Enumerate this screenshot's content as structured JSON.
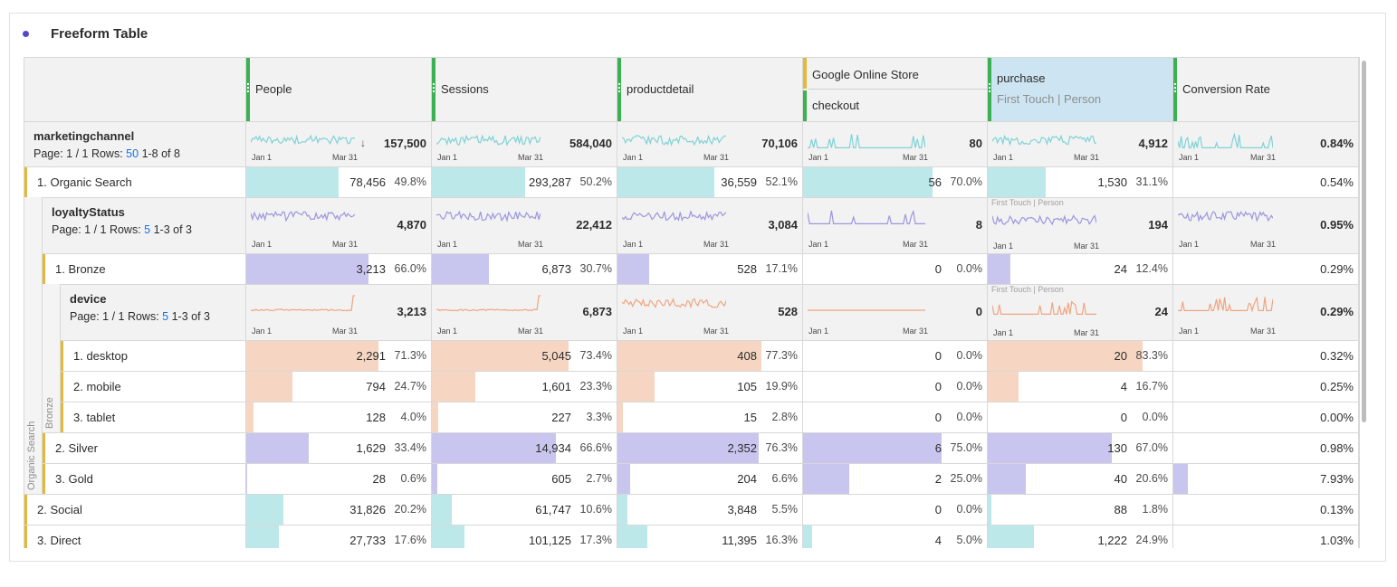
{
  "panel": {
    "title": "Freeform Table"
  },
  "colors": {
    "teal": "#bce8ea",
    "lavender": "#c8c5ee",
    "peach": "#f6d6c2",
    "green_bar": "#3bb151",
    "yellow_bar": "#e2b93b",
    "link": "#1473e6"
  },
  "columns": [
    {
      "label": "People"
    },
    {
      "label": "Sessions"
    },
    {
      "label": "productdetail"
    },
    {
      "label": "Google Online Store",
      "label2": "checkout"
    },
    {
      "label": "purchase",
      "label2": "First Touch | Person"
    },
    {
      "label": "Conversion Rate"
    }
  ],
  "spark_axis": {
    "start": "Jan 1",
    "end": "Mar 31"
  },
  "first_touch_label": "First Touch | Person",
  "side_labels": {
    "outer": "Organic Search",
    "inner": "Bronze"
  },
  "marketing": {
    "name": "marketingchannel",
    "page": "Page: 1 / 1",
    "rows_label": "Rows:",
    "rows": "50",
    "range": "1-8 of 8",
    "trend_icon": "arrow-down-icon",
    "totals": [
      "157,500",
      "584,040",
      "70,106",
      "80",
      "4,912",
      "0.84%"
    ]
  },
  "organic": {
    "label": "1. Organic Search",
    "values": [
      "78,456",
      "293,287",
      "36,559",
      "56",
      "1,530",
      "0.54%"
    ],
    "pcts": [
      "49.8%",
      "50.2%",
      "52.1%",
      "70.0%",
      "31.1%"
    ],
    "fractions": [
      0.498,
      0.502,
      0.521,
      0.7,
      0.311
    ]
  },
  "loyalty": {
    "name": "loyaltyStatus",
    "page": "Page: 1 / 1",
    "rows_label": "Rows:",
    "rows": "5",
    "range": "1-3 of 3",
    "totals": [
      "4,870",
      "22,412",
      "3,084",
      "8",
      "194",
      "0.95%"
    ]
  },
  "bronze": {
    "label": "1. Bronze",
    "values": [
      "3,213",
      "6,873",
      "528",
      "0",
      "24",
      "0.29%"
    ],
    "pcts": [
      "66.0%",
      "30.7%",
      "17.1%",
      "0.0%",
      "12.4%"
    ],
    "fractions": [
      0.66,
      0.307,
      0.171,
      0,
      0.124
    ]
  },
  "device": {
    "name": "device",
    "page": "Page: 1 / 1",
    "rows_label": "Rows:",
    "rows": "5",
    "range": "1-3 of 3",
    "totals": [
      "3,213",
      "6,873",
      "528",
      "0",
      "24",
      "0.29%"
    ]
  },
  "device_rows": [
    {
      "label": "1. desktop",
      "values": [
        "2,291",
        "5,045",
        "408",
        "0",
        "20",
        "0.32%"
      ],
      "pcts": [
        "71.3%",
        "73.4%",
        "77.3%",
        "0.0%",
        "83.3%"
      ],
      "fractions": [
        0.713,
        0.734,
        0.773,
        0,
        0.833
      ]
    },
    {
      "label": "2. mobile",
      "values": [
        "794",
        "1,601",
        "105",
        "0",
        "4",
        "0.25%"
      ],
      "pcts": [
        "24.7%",
        "23.3%",
        "19.9%",
        "0.0%",
        "16.7%"
      ],
      "fractions": [
        0.247,
        0.233,
        0.199,
        0,
        0.167
      ]
    },
    {
      "label": "3. tablet",
      "values": [
        "128",
        "227",
        "15",
        "0",
        "0",
        "0.00%"
      ],
      "pcts": [
        "4.0%",
        "3.3%",
        "2.8%",
        "0.0%",
        "0.0%"
      ],
      "fractions": [
        0.04,
        0.033,
        0.028,
        0,
        0
      ]
    }
  ],
  "loyalty_rows": [
    {
      "label": "2. Silver",
      "values": [
        "1,629",
        "14,934",
        "2,352",
        "6",
        "130",
        "0.98%"
      ],
      "pcts": [
        "33.4%",
        "66.6%",
        "76.3%",
        "75.0%",
        "67.0%"
      ],
      "fractions": [
        0.334,
        0.666,
        0.763,
        0.75,
        0.67
      ],
      "conv_fraction": 0
    },
    {
      "label": "3. Gold",
      "values": [
        "28",
        "605",
        "204",
        "2",
        "40",
        "7.93%"
      ],
      "pcts": [
        "0.6%",
        "2.7%",
        "6.6%",
        "25.0%",
        "20.6%"
      ],
      "fractions": [
        0.006,
        0.027,
        0.066,
        0.25,
        0.206
      ],
      "conv_fraction": 0.08
    }
  ],
  "channel_rows": [
    {
      "label": "2. Social",
      "values": [
        "31,826",
        "61,747",
        "3,848",
        "0",
        "88",
        "0.13%"
      ],
      "pcts": [
        "20.2%",
        "10.6%",
        "5.5%",
        "0.0%",
        "1.8%"
      ],
      "fractions": [
        0.202,
        0.106,
        0.055,
        0,
        0.018
      ]
    },
    {
      "label": "3. Direct",
      "values": [
        "27,733",
        "101,125",
        "11,395",
        "4",
        "1,222",
        "1.03%"
      ],
      "pcts": [
        "17.6%",
        "17.3%",
        "16.3%",
        "5.0%",
        "24.9%"
      ],
      "fractions": [
        0.176,
        0.173,
        0.163,
        0.05,
        0.249
      ]
    }
  ]
}
